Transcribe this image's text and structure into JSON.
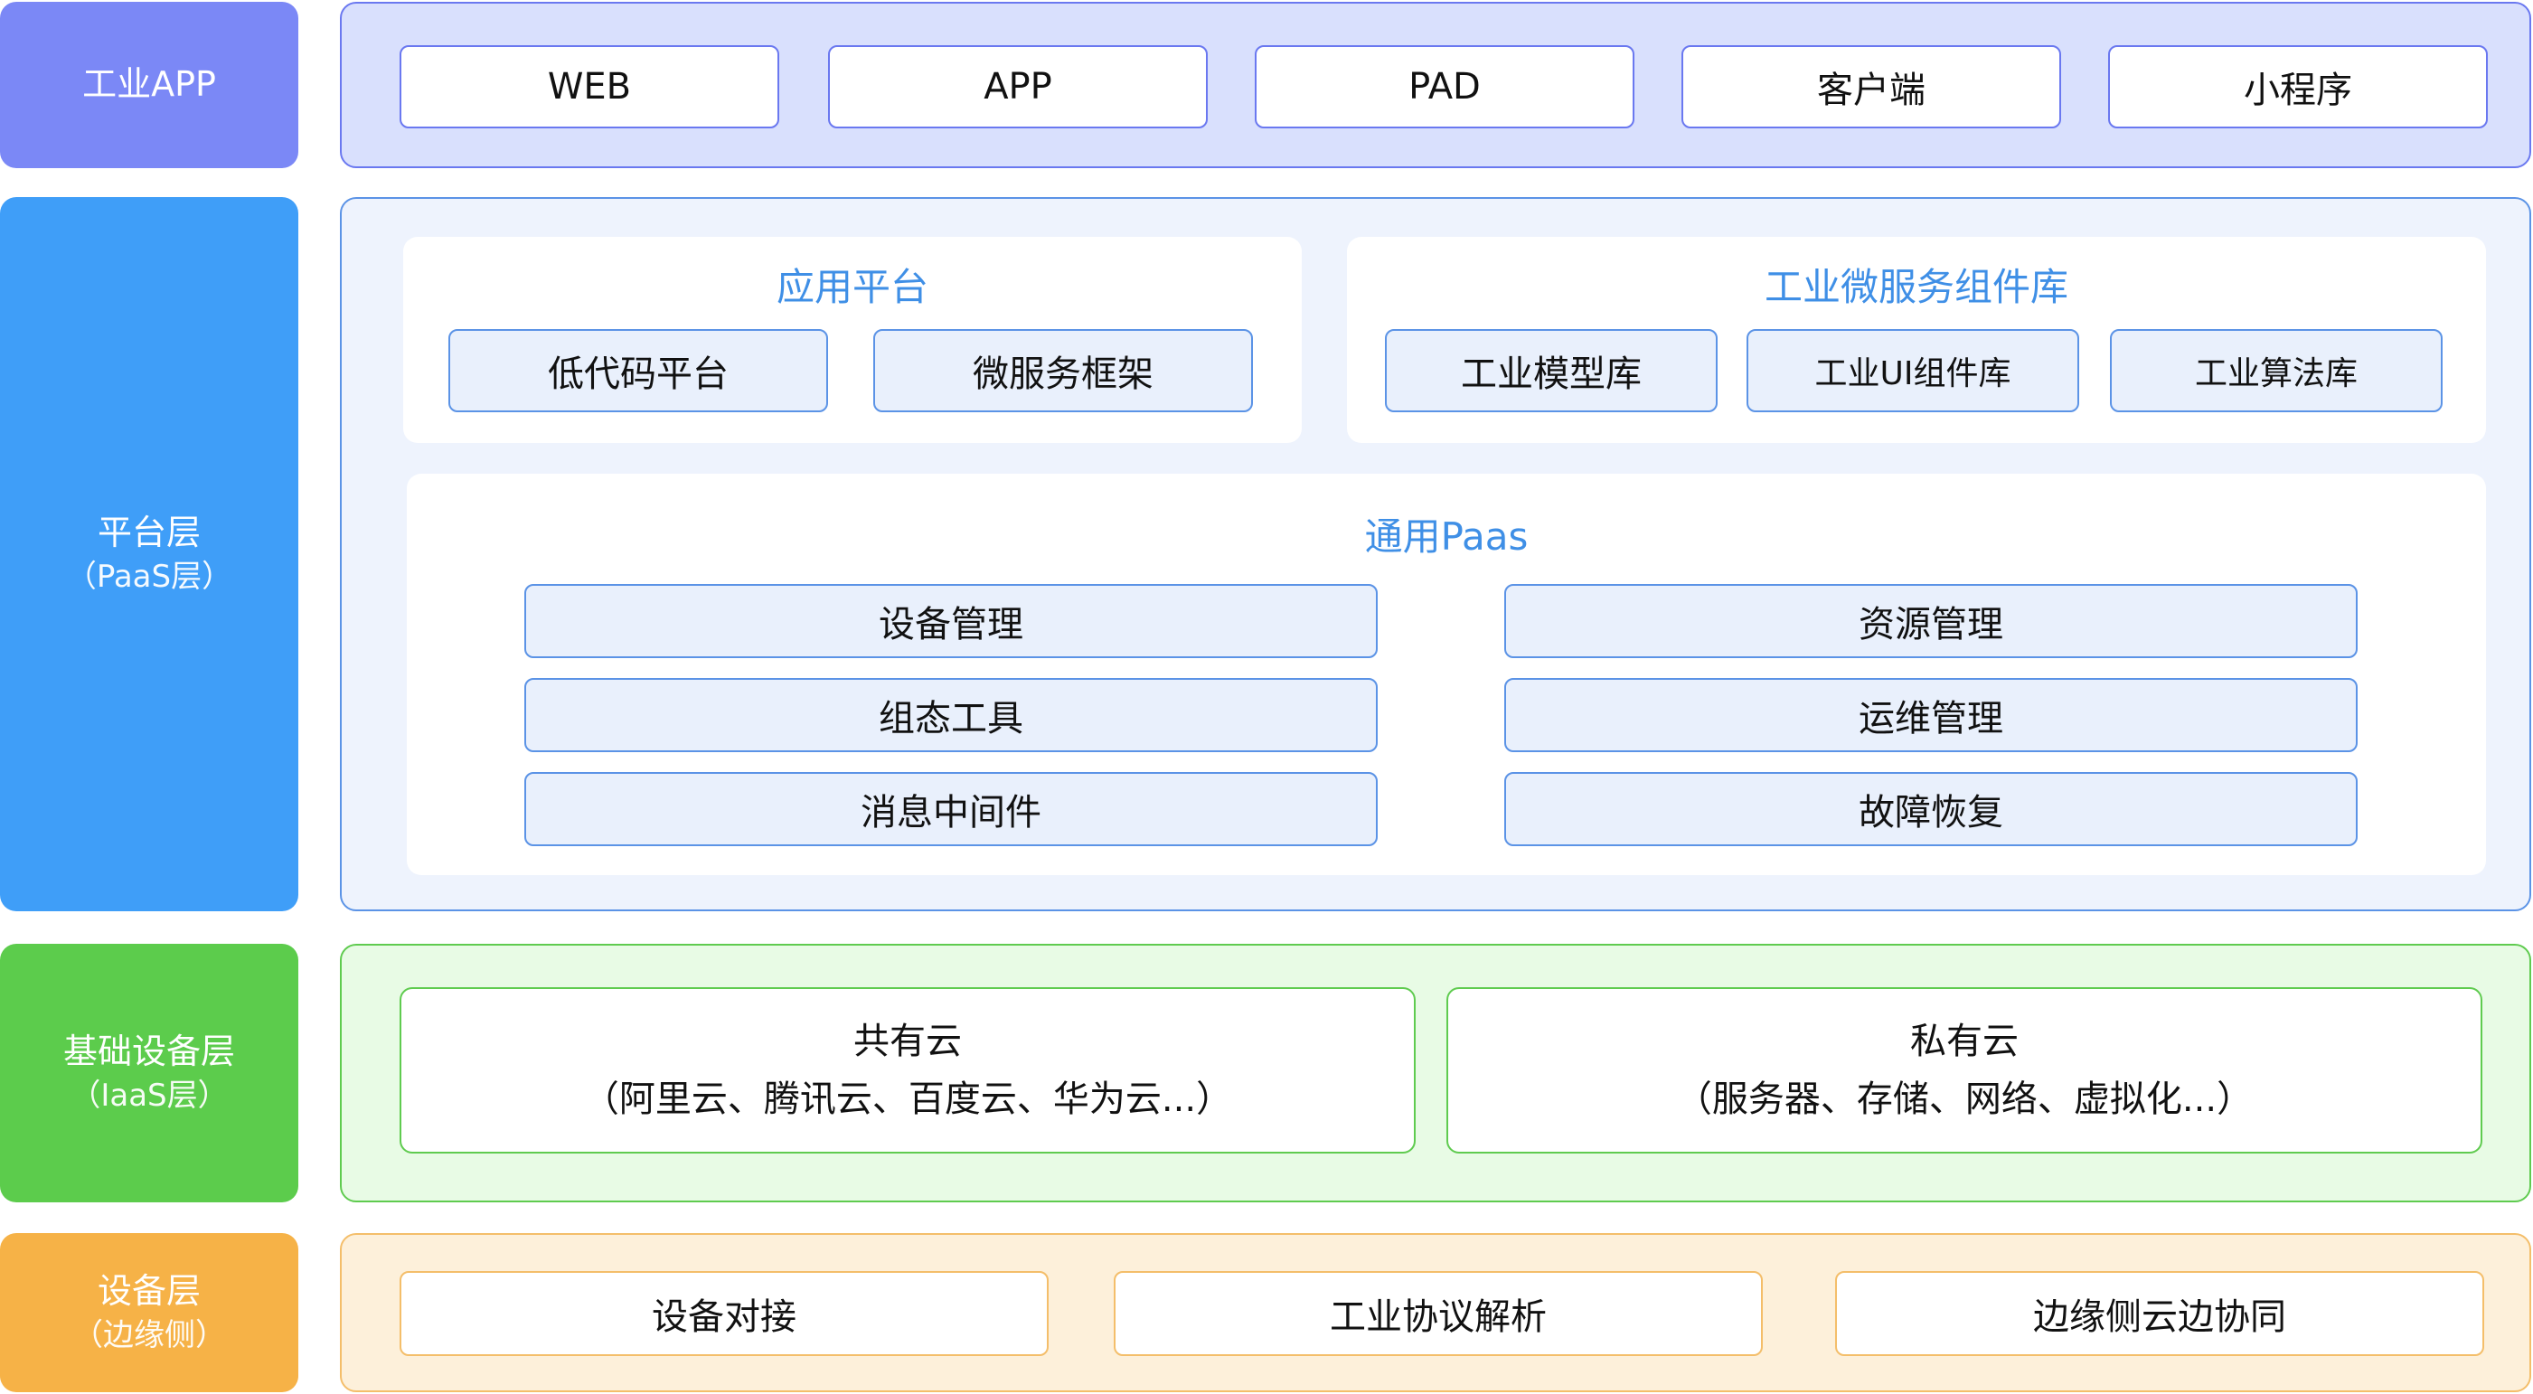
{
  "colors": {
    "app_label": "#7b88f6",
    "app_panel_bg": "#d9e0fd",
    "app_panel_border": "#6a78f0",
    "paas_label": "#3f9ef8",
    "paas_panel_bg": "#eef3fd",
    "paas_panel_border": "#5b93e6",
    "iaas_label": "#5ccc4c",
    "iaas_panel_bg": "#e8fbe5",
    "iaas_panel_border": "#5fcb4f",
    "device_label": "#f6b247",
    "device_panel_bg": "#fdf0da",
    "device_panel_border": "#f4be6a",
    "section_title": "#3f8fe6"
  },
  "layers": {
    "app": {
      "label": "工业APP",
      "items": [
        "WEB",
        "APP",
        "PAD",
        "客户端",
        "小程序"
      ]
    },
    "paas": {
      "label": "平台层",
      "sublabel": "（PaaS层）",
      "app_platform": {
        "title": "应用平台",
        "items": [
          "低代码平台",
          "微服务框架"
        ]
      },
      "microservice_lib": {
        "title": "工业微服务组件库",
        "items": [
          "工业模型库",
          "工业UI组件库",
          "工业算法库"
        ]
      },
      "general_paas": {
        "title": "通用Paas",
        "left": [
          "设备管理",
          "组态工具",
          "消息中间件"
        ],
        "right": [
          "资源管理",
          "运维管理",
          "故障恢复"
        ]
      }
    },
    "iaas": {
      "label": "基础设备层",
      "sublabel": "（IaaS层）",
      "public_cloud": {
        "title": "共有云",
        "detail": "（阿里云、腾讯云、百度云、华为云...）"
      },
      "private_cloud": {
        "title": "私有云",
        "detail": "（服务器、存储、网络、虚拟化...）"
      }
    },
    "device": {
      "label": "设备层",
      "sublabel": "（边缘侧）",
      "items": [
        "设备对接",
        "工业协议解析",
        "边缘侧云边协同"
      ]
    }
  }
}
